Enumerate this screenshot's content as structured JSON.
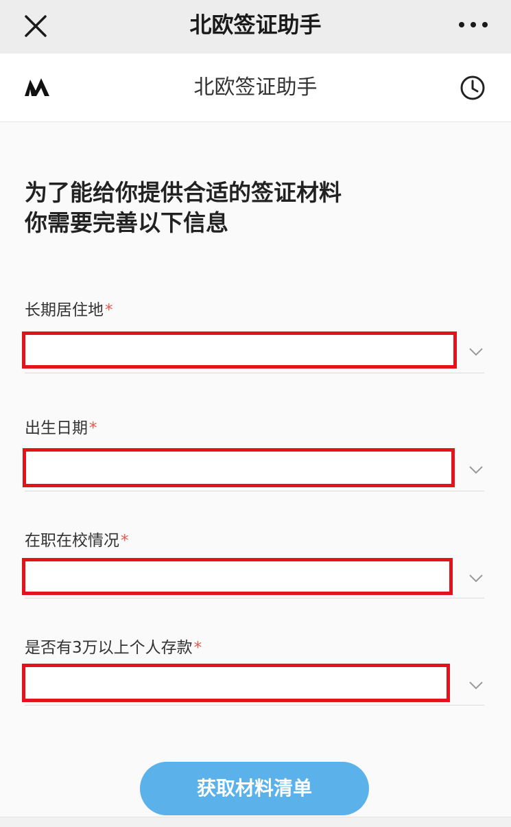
{
  "window": {
    "title": "北欧签证助手",
    "close_icon": "close-icon",
    "more_icon": "more-horizontal-icon"
  },
  "header": {
    "title": "北欧签证助手",
    "logo_icon": "mafengwo-logo-icon",
    "history_icon": "clock-icon"
  },
  "intro": {
    "line1": "为了能给你提供合适的签证材料",
    "line2": "你需要完善以下信息"
  },
  "form": {
    "fields": [
      {
        "label": "长期居住地",
        "required_mark": "*",
        "value": ""
      },
      {
        "label": "出生日期",
        "required_mark": "*",
        "value": ""
      },
      {
        "label": "在职在校情况",
        "required_mark": "*",
        "value": ""
      },
      {
        "label": "是否有3万以上个人存款",
        "required_mark": "*",
        "value": ""
      }
    ],
    "submit_label": "获取材料清单"
  },
  "colors": {
    "accent_button": "#5bb2ea",
    "required_mark": "#e05a4e",
    "highlight_box": "#e3131c"
  }
}
